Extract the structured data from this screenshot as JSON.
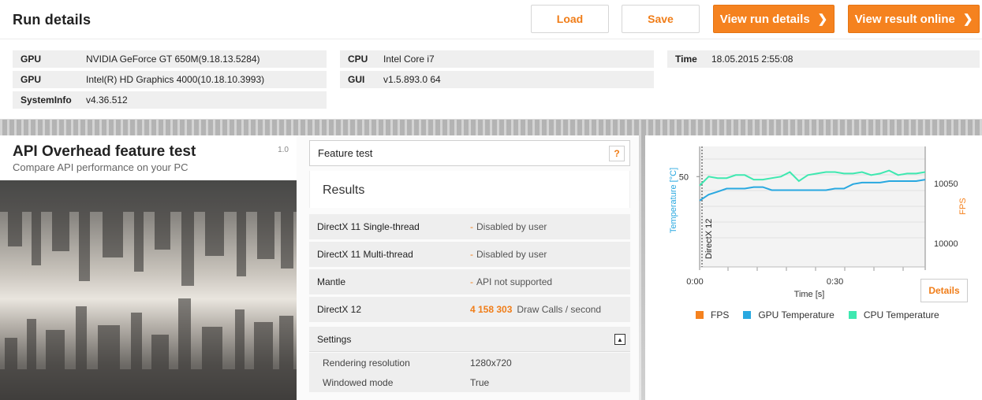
{
  "run": {
    "title": "Run details",
    "buttons": {
      "load": "Load",
      "save": "Save",
      "view_run_details": "View run details",
      "view_result_online": "View result online"
    },
    "info": {
      "gpu1_key": "GPU",
      "gpu1_val": "NVIDIA GeForce GT 650M(9.18.13.5284)",
      "gpu2_key": "GPU",
      "gpu2_val": "Intel(R) HD Graphics 4000(10.18.10.3993)",
      "sysinfo_key": "SystemInfo",
      "sysinfo_val": "v4.36.512",
      "cpu_key": "CPU",
      "cpu_val": "Intel Core i7",
      "gui_key": "GUI",
      "gui_val": "v1.5.893.0 64",
      "time_key": "Time",
      "time_val": "18.05.2015 2:55:08"
    }
  },
  "feature": {
    "title": "API Overhead feature test",
    "subtitle": "Compare API performance on your PC",
    "version": "1.0"
  },
  "results": {
    "feature_test_label": "Feature test",
    "help_label": "?",
    "heading": "Results",
    "rows": [
      {
        "name": "DirectX 11 Single-thread",
        "value": "Disabled by user"
      },
      {
        "name": "DirectX 11 Multi-thread",
        "value": "Disabled by user"
      },
      {
        "name": "Mantle",
        "value": "API not supported"
      },
      {
        "name": "DirectX 12",
        "score": "4 158 303",
        "unit": "Draw Calls / second"
      }
    ],
    "dash": "-",
    "settings_label": "Settings",
    "settings": [
      {
        "key": "Rendering resolution",
        "value": "1280x720"
      },
      {
        "key": "Windowed mode",
        "value": "True"
      }
    ]
  },
  "chart_data": {
    "type": "line",
    "x": [
      0,
      2,
      4,
      6,
      8,
      10,
      12,
      14,
      16,
      18,
      20,
      22,
      24,
      26,
      28,
      30,
      32,
      34,
      36,
      38,
      40,
      42,
      44,
      46,
      48,
      50
    ],
    "series": [
      {
        "name": "FPS",
        "values": [],
        "color": "#f5821f"
      },
      {
        "name": "GPU Temperature",
        "values": [
          42,
          44,
          45,
          46,
          46,
          46,
          46.5,
          46.5,
          45.5,
          45.5,
          45.5,
          45.5,
          45.5,
          45.5,
          45.5,
          46,
          46,
          47.5,
          48,
          48,
          48,
          48.5,
          48.5,
          48.5,
          48.5,
          49
        ],
        "color": "#29a8e0"
      },
      {
        "name": "CPU Temperature",
        "values": [
          47,
          50,
          49.5,
          49.5,
          50.5,
          50.5,
          49,
          49,
          49.5,
          50,
          51.5,
          48.5,
          50.5,
          51,
          51.5,
          51.5,
          51,
          51,
          51.5,
          50.5,
          51,
          52,
          50.5,
          51,
          51,
          51.5
        ],
        "color": "#3ee8b0"
      }
    ],
    "marker_label": "DirectX 12",
    "xlabel": "Time [s]",
    "ylabel_left": "Temperature [°C]",
    "ylabel_right": "FPS",
    "x_ticks": [
      "0:00",
      "0:30"
    ],
    "y_left_ticks": [
      "50"
    ],
    "y_right_ticks": [
      "10050",
      "10000"
    ],
    "xlim": [
      0,
      50
    ],
    "ylim_left": [
      20,
      60
    ],
    "grid": "horizontal"
  },
  "chart": {
    "details_label": "Details"
  }
}
